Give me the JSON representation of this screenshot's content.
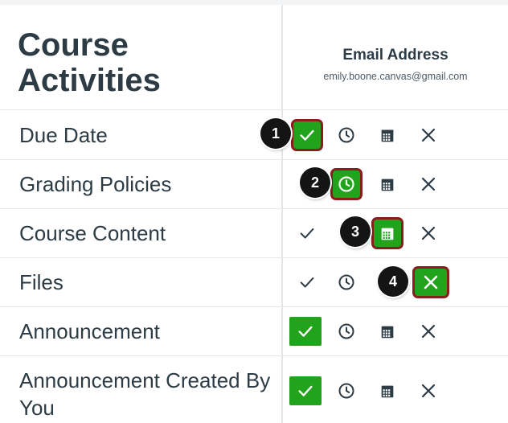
{
  "title": "Course Activities",
  "column": {
    "label": "Email Address",
    "email": "emily.boone.canvas@gmail.com"
  },
  "colors": {
    "selected_green": "#22a31c",
    "highlight_red": "#8a1e1e",
    "text_dark": "#2d3b45",
    "badge_black": "#141414"
  },
  "options": [
    "checkmark-icon",
    "clock-icon",
    "calendar-icon",
    "close-icon"
  ],
  "rows": [
    {
      "label": "Due Date",
      "selected": "checkmark",
      "badge": "1"
    },
    {
      "label": "Grading Policies",
      "selected": "clock",
      "badge": "2"
    },
    {
      "label": "Course Content",
      "selected": "calendar",
      "badge": "3"
    },
    {
      "label": "Files",
      "selected": "close",
      "badge": "4"
    },
    {
      "label": "Announcement",
      "selected": "checkmark",
      "badge": ""
    },
    {
      "label": "Announcement Created By You",
      "selected": "checkmark",
      "badge": ""
    }
  ]
}
